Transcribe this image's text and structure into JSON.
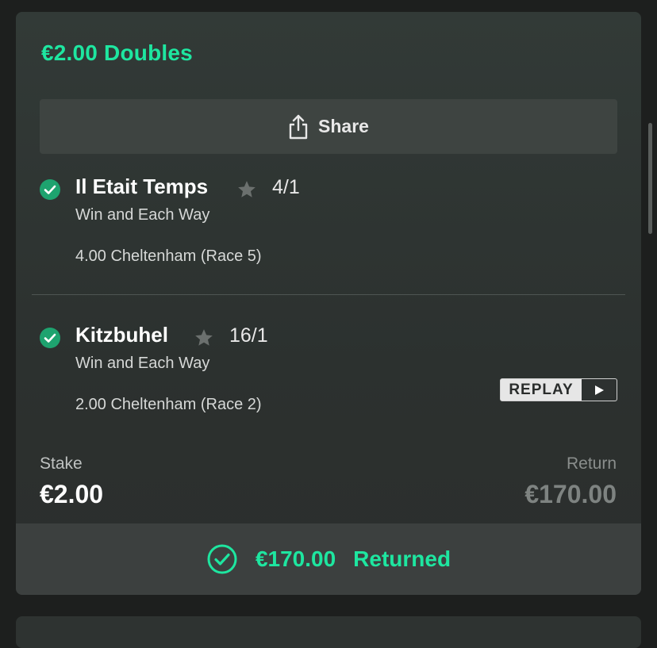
{
  "bet": {
    "title": "€2.00 Doubles",
    "share_label": "Share",
    "selections": [
      {
        "name": "Il Etait Temps",
        "odds": "4/1",
        "market": "Win and Each Way",
        "event": "4.00 Cheltenham (Race 5)",
        "status_icon": "check-circle-icon",
        "favourite_icon": "star-icon"
      },
      {
        "name": "Kitzbuhel",
        "odds": "16/1",
        "market": "Win and Each Way",
        "event": "2.00 Cheltenham (Race 2)",
        "status_icon": "check-circle-icon",
        "favourite_icon": "star-icon"
      }
    ],
    "replay_label": "REPLAY",
    "stake_label": "Stake",
    "stake_value": "€2.00",
    "return_label": "Return",
    "return_value": "€170.00",
    "returned_amount": "€170.00",
    "returned_label": "Returned"
  },
  "colors": {
    "accent": "#1ee6a0",
    "win_check": "#1ea36f",
    "card_bg": "#2f3533",
    "button_bg": "#3e4441"
  }
}
